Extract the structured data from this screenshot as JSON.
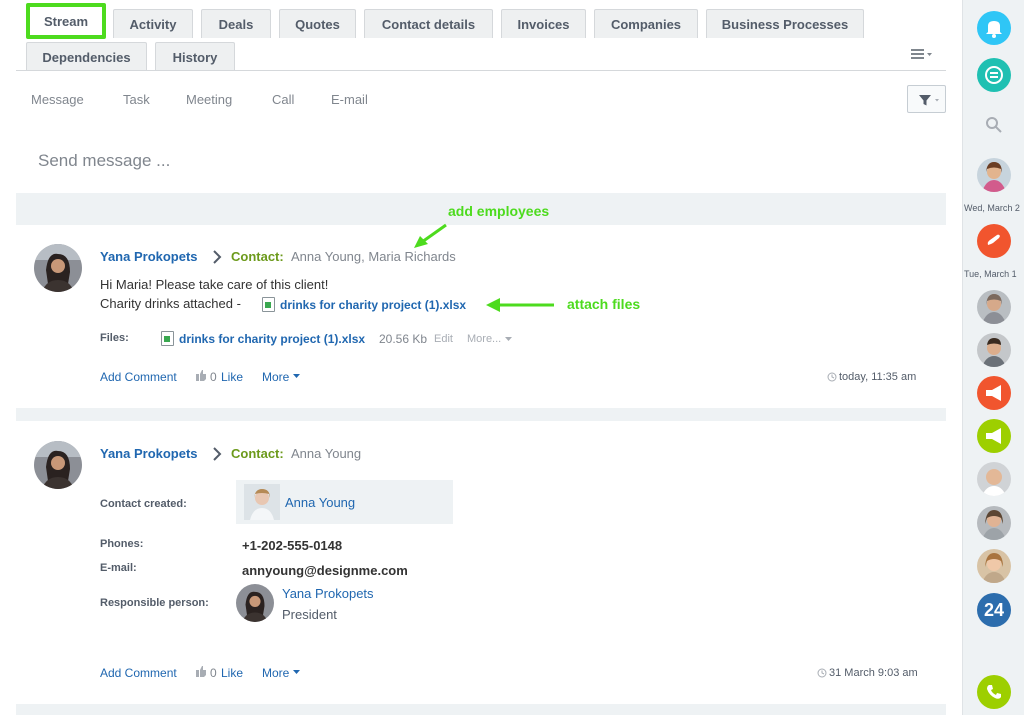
{
  "tabs": {
    "row1": [
      "Stream",
      "Activity",
      "Deals",
      "Quotes",
      "Contact details",
      "Invoices",
      "Companies",
      "Business Processes"
    ],
    "row2": [
      "Dependencies",
      "History"
    ],
    "active": "Stream"
  },
  "composer": {
    "tabs": [
      "Message",
      "Task",
      "Meeting",
      "Call",
      "E-mail"
    ],
    "placeholder": "Send message ..."
  },
  "annotations": {
    "add_employees": "add employees",
    "attach_files": "attach files",
    "color": "#4ddb1e"
  },
  "post1": {
    "author": "Yana Prokopets",
    "contact_label": "Contact:",
    "contacts": "Anna Young, Maria Richards",
    "line1": "Hi Maria! Please take care of this client!",
    "line2_prefix": "Charity drinks attached  -",
    "inline_file": "drinks for charity project (1).xlsx",
    "files_label": "Files:",
    "file_name": "drinks for charity project (1).xlsx",
    "file_size": "20.56 Kb",
    "edit": "Edit",
    "more_file": "More...",
    "add_comment": "Add Comment",
    "like_count": "0",
    "like": "Like",
    "more": "More",
    "time": "today, 11:35 am"
  },
  "post2": {
    "author": "Yana Prokopets",
    "contact_label": "Contact:",
    "contacts": "Anna Young",
    "contact_created_label": "Contact created:",
    "contact_card_name": "Anna Young",
    "phones_label": "Phones:",
    "phone": "+1-202-555-0148",
    "email_label": "E-mail:",
    "email": "annyoung@designme.com",
    "responsible_label": "Responsible person:",
    "responsible_name": "Yana Prokopets",
    "responsible_title": "President",
    "add_comment": "Add Comment",
    "like_count": "0",
    "like": "Like",
    "more": "More",
    "time": "31 March 9:03 am"
  },
  "rail": {
    "date1": "Wed, March 2",
    "date2": "Tue, March 1",
    "badge_24": "24"
  }
}
